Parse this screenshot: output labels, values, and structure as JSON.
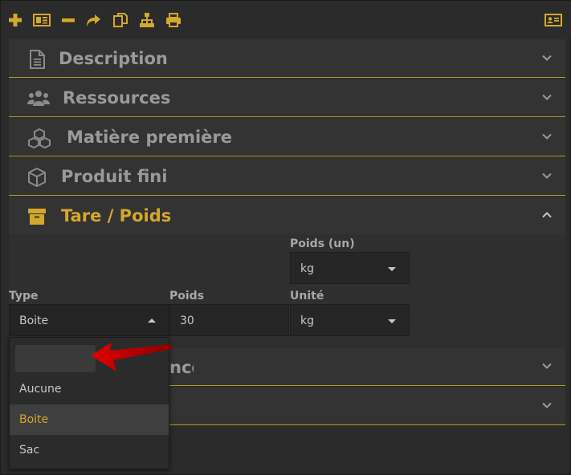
{
  "toolbar": {
    "icons": [
      "plus-icon",
      "id-card-icon",
      "minus-icon",
      "share-arrow-icon",
      "copy-icon",
      "sitemap-icon",
      "print-icon",
      "address-card-icon"
    ]
  },
  "sections": [
    {
      "title": "Description",
      "icon": "file-text-icon"
    },
    {
      "title": "Ressources",
      "icon": "users-icon"
    },
    {
      "title": "Matière première",
      "icon": "cubes-icon"
    },
    {
      "title": "Produit fini",
      "icon": "cube-icon"
    },
    {
      "title": "Tare / Poids",
      "icon": "archive-box-icon",
      "expanded": true
    },
    {
      "title_suffix": "nce"
    },
    {
      "title": ""
    }
  ],
  "tare": {
    "poids_un_label": "Poids (un)",
    "poids_un_value": "kg",
    "type_label": "Type",
    "type_value": "Boite",
    "poids_label": "Poids",
    "poids_value": "30",
    "unite_label": "Unité",
    "unite_value": "kg"
  },
  "dropdown": {
    "search_value": "",
    "options": [
      "Aucune",
      "Boite",
      "Sac"
    ],
    "selected": "Boite"
  },
  "colors": {
    "accent": "#d4a82a",
    "background": "#2b2b2b",
    "section_bg": "#333333",
    "pointer": "#d40000"
  }
}
